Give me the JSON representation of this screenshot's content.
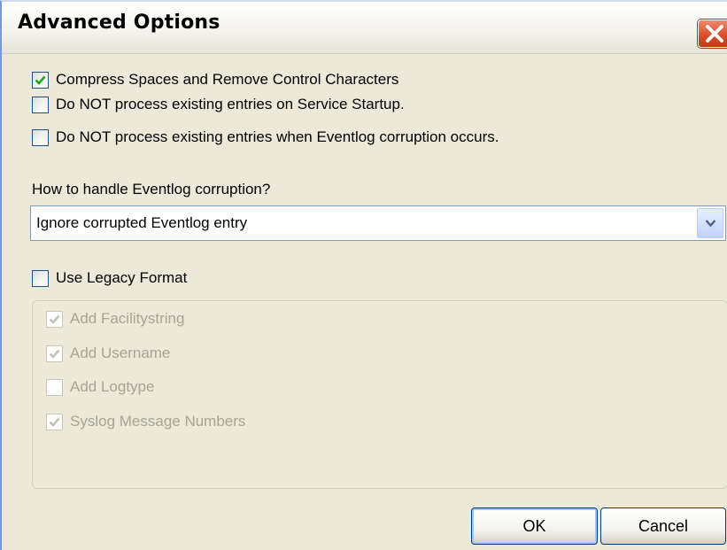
{
  "window": {
    "title": "Advanced Options"
  },
  "options": [
    {
      "label": "Compress Spaces and Remove Control Characters",
      "checked": true
    },
    {
      "label": "Do NOT process existing entries on Service Startup.",
      "checked": false
    },
    {
      "label": "Do NOT process existing entries when Eventlog corruption occurs.",
      "checked": false
    }
  ],
  "corruption": {
    "label": "How to handle Eventlog corruption?",
    "selected": "Ignore corrupted Eventlog entry"
  },
  "legacy": {
    "label": "Use Legacy Format",
    "checked": false,
    "items": [
      {
        "label": "Add Facilitystring",
        "checked": true,
        "enabled": false
      },
      {
        "label": "Add Username",
        "checked": true,
        "enabled": false
      },
      {
        "label": "Add Logtype",
        "checked": false,
        "enabled": false
      },
      {
        "label": "Syslog Message Numbers",
        "checked": true,
        "enabled": false
      }
    ]
  },
  "buttons": {
    "ok": "OK",
    "cancel": "Cancel"
  },
  "colors": {
    "checkmark": "#21a121",
    "checkmark_disabled": "#c4c2b3",
    "close": "#d9502a"
  }
}
